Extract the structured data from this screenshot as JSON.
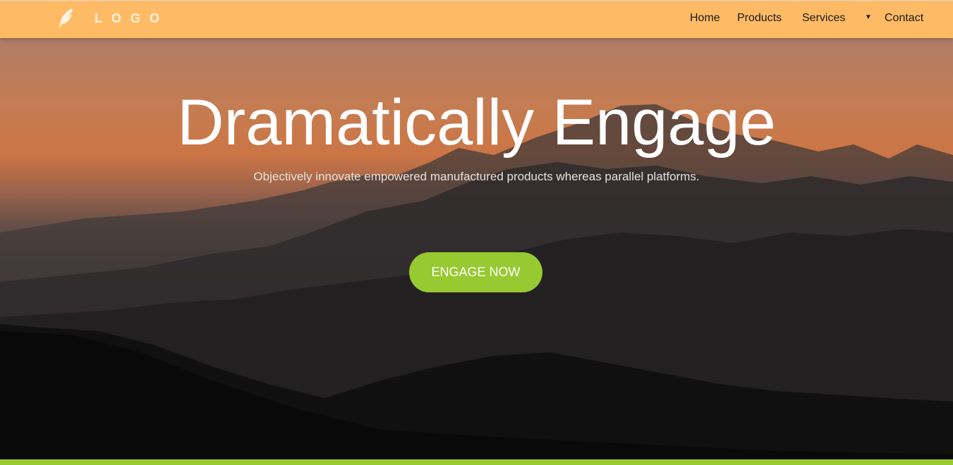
{
  "header": {
    "logo_text": "LOGO",
    "logo_icon": "feather-icon",
    "nav": [
      {
        "label": "Home"
      },
      {
        "label": "Products"
      },
      {
        "label": "Services"
      },
      {
        "label": "Contact"
      }
    ],
    "dropdown_caret": "▼",
    "background_color": "#ffba66"
  },
  "hero": {
    "title": "Dramatically Engage",
    "subtitle": "Objectively innovate empowered manufactured products whereas parallel platforms.",
    "cta_label": "ENGAGE NOW",
    "accent_color": "#97c931"
  }
}
